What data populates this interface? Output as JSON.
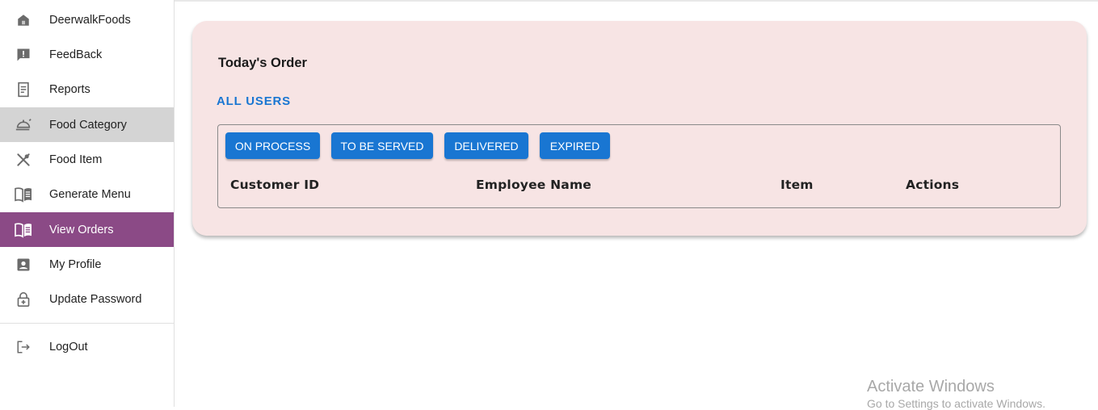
{
  "sidebar": {
    "items": [
      {
        "label": "DeerwalkFoods",
        "icon": "home-icon"
      },
      {
        "label": "FeedBack",
        "icon": "feedback-icon"
      },
      {
        "label": "Reports",
        "icon": "receipt-icon"
      },
      {
        "label": "Food Category",
        "icon": "room-service-icon"
      },
      {
        "label": "Food Item",
        "icon": "restaurant-icon"
      },
      {
        "label": "Generate Menu",
        "icon": "menu-book-icon"
      },
      {
        "label": "View Orders",
        "icon": "menu-book-icon"
      },
      {
        "label": "My Profile",
        "icon": "account-box-icon"
      },
      {
        "label": "Update Password",
        "icon": "lock-icon"
      }
    ],
    "logout": {
      "label": "LogOut",
      "icon": "logout-icon"
    },
    "active_color": "#8b4a86"
  },
  "main": {
    "title": "Today's Order",
    "filter_link": "ALL USERS",
    "status_buttons": [
      "ON PROCESS",
      "TO BE SERVED",
      "DELIVERED",
      "EXPIRED"
    ],
    "columns": [
      "Customer ID",
      "Employee Name",
      "Item",
      "Actions"
    ],
    "accent_color": "#1976d2",
    "card_color": "#f7e4e4"
  },
  "watermark": {
    "line1": "Activate Windows",
    "line2": "Go to Settings to activate Windows."
  }
}
